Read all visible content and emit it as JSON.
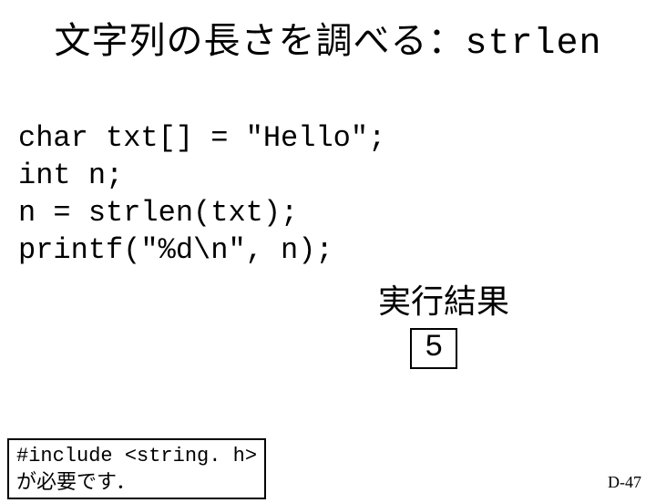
{
  "title_prefix": "文字列の長さを調べる：",
  "title_mono": "strlen",
  "code": {
    "line1": "char txt[] = \"Hello\";",
    "line2": "int n;",
    "line3": "n = strlen(txt);",
    "line4": "printf(\"%d\\n\", n);"
  },
  "result_label": "実行結果",
  "result_value": "5",
  "note_mono": "#include <string. h>",
  "note_tail": "が必要です．",
  "page_number": "D-47"
}
